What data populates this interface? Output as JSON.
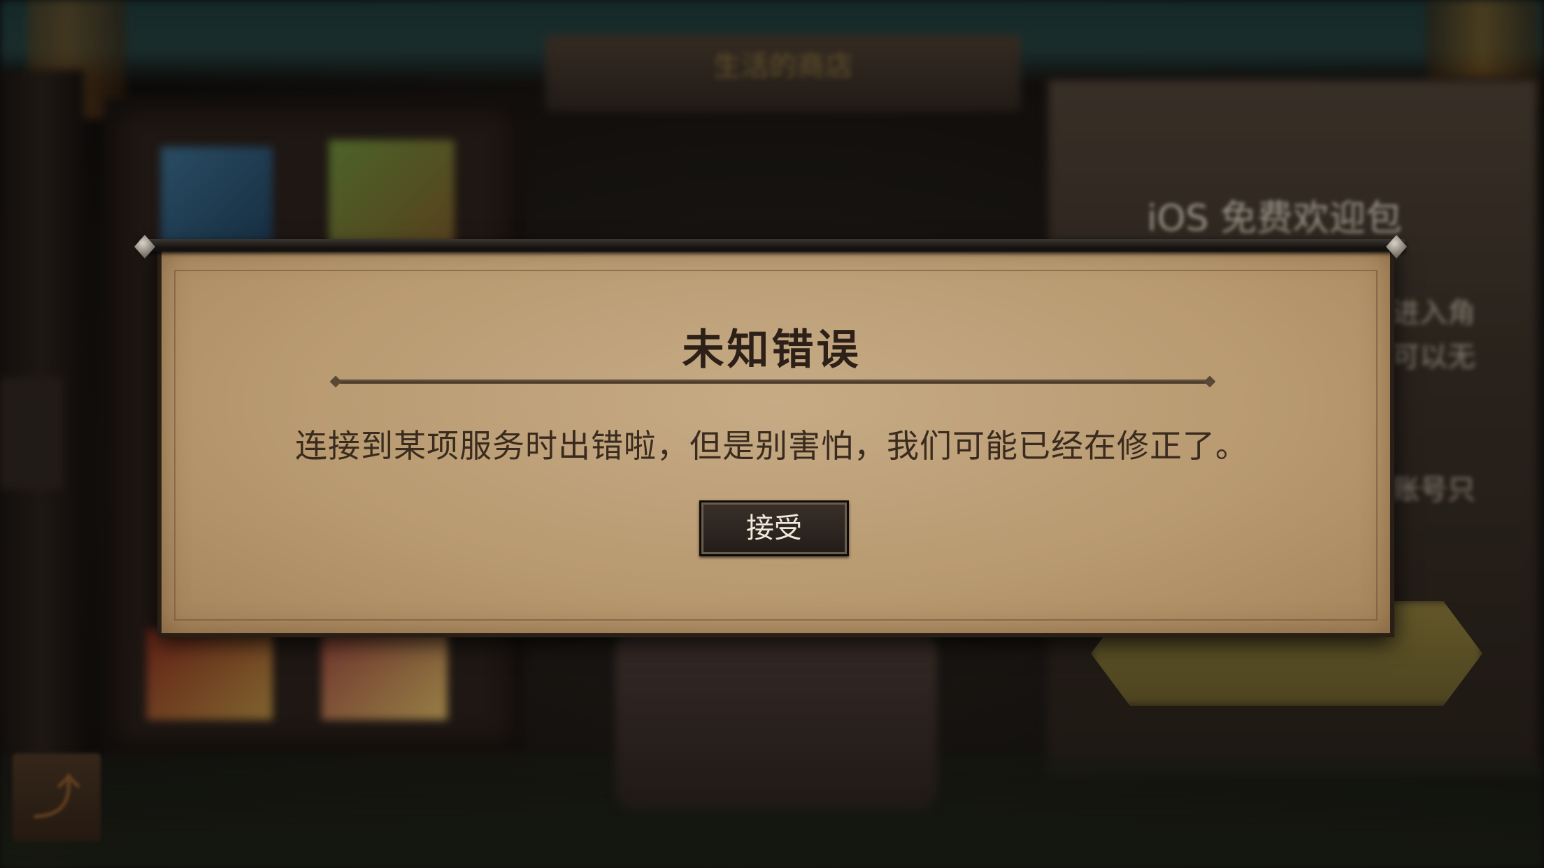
{
  "background": {
    "sign_text": "生活的商店",
    "banner_title": "iOS 免费欢迎包",
    "banner_lines": [
      "进入角",
      "可以无",
      "账号只"
    ]
  },
  "dialog": {
    "title": "未知错误",
    "message": "连接到某项服务时出错啦，但是别害怕，我们可能已经在修正了。",
    "accept_label": "接受"
  },
  "icons": {
    "back": "back-arrow-icon",
    "home": "home-icon"
  },
  "colors": {
    "parchment": "#c6ab86",
    "button_bg": "#2c241f",
    "button_text": "#f1e9dc",
    "title_text": "#2c2018"
  }
}
